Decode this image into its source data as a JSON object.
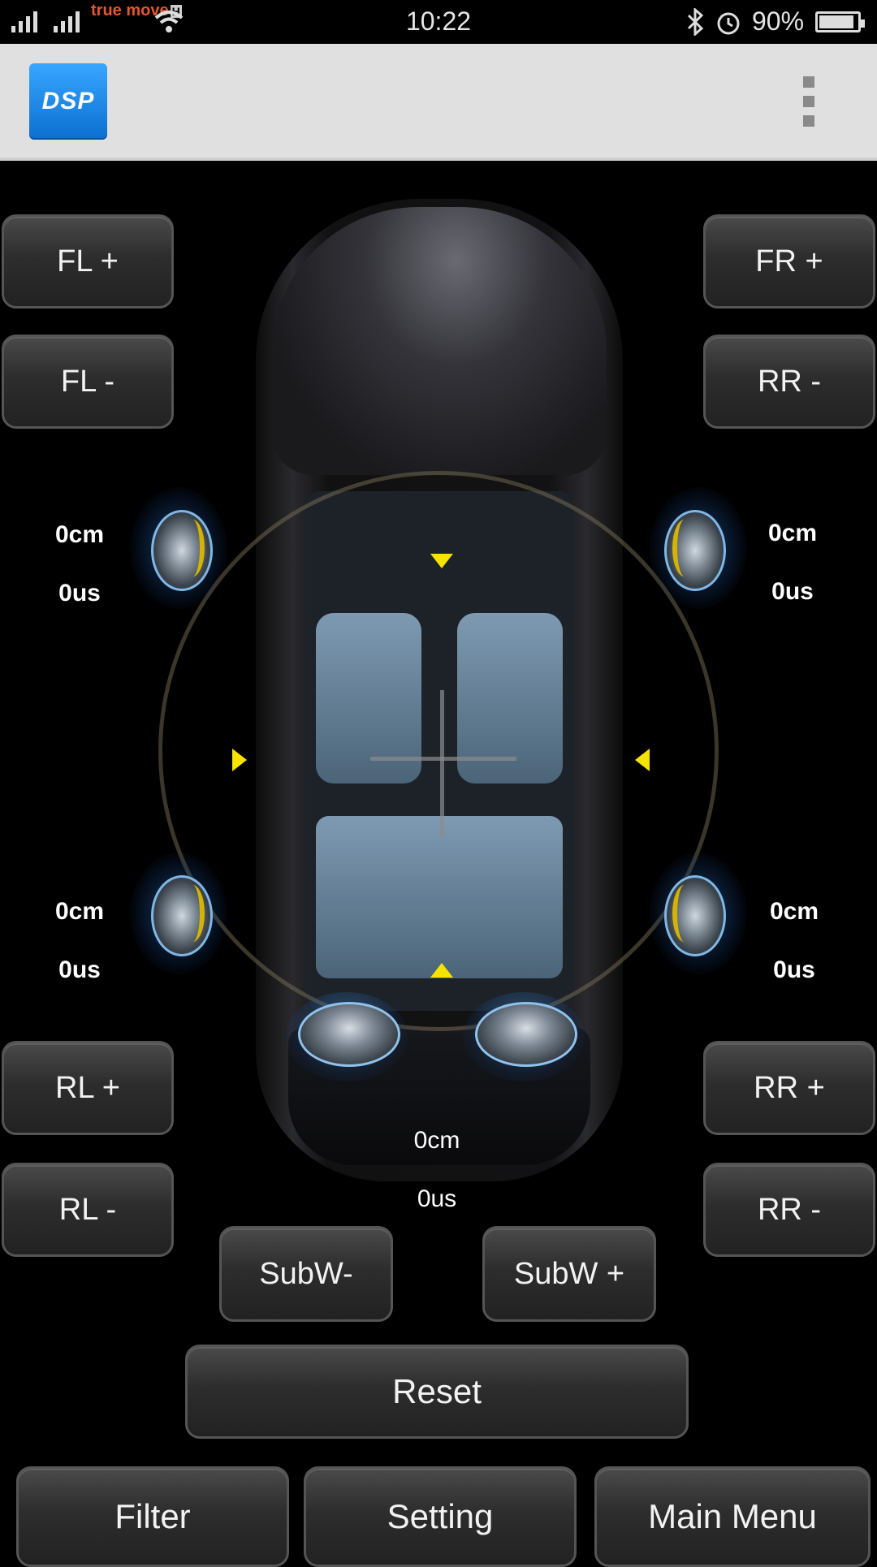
{
  "status_bar": {
    "time": "10:22",
    "carrier": "true move",
    "network_badge": "H",
    "battery_percent": "90%",
    "battery_level": 0.9,
    "icons": [
      "signal-icon",
      "signal-icon",
      "wifi-icon",
      "bluetooth-icon",
      "alarm-icon",
      "battery-icon"
    ]
  },
  "app_bar": {
    "logo_text": "DSP",
    "menu_icon": "overflow-menu-icon"
  },
  "buttons": {
    "fl_plus": "FL +",
    "fl_minus": "FL -",
    "fr_plus": "FR +",
    "fr_minus": "RR -",
    "rl_plus": "RL +",
    "rl_minus": "RL -",
    "rr_plus": "RR +",
    "rr_minus": "RR -",
    "subw_minus": "SubW-",
    "subw_plus": "SubW +",
    "reset": "Reset",
    "filter": "Filter",
    "setting": "Setting",
    "main_menu": "Main Menu"
  },
  "delays": {
    "front_left": {
      "distance": "0cm",
      "time": "0us"
    },
    "front_right": {
      "distance": "0cm",
      "time": "0us"
    },
    "rear_left": {
      "distance": "0cm",
      "time": "0us"
    },
    "rear_right": {
      "distance": "0cm",
      "time": "0us"
    },
    "subwoofer": {
      "distance": "0cm",
      "time": "0us"
    }
  },
  "colors": {
    "background": "#000000",
    "button": "#2d2d2d",
    "app_bar": "#e0e0e0",
    "logo": "#1a86e8",
    "focus_arrow": "#f6e300"
  }
}
